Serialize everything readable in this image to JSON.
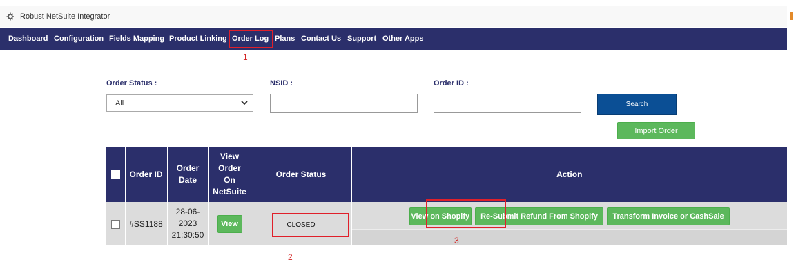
{
  "window": {
    "title": "Robust NetSuite Integrator",
    "icon": "gear-icon"
  },
  "nav": {
    "items": [
      {
        "label": "Dashboard"
      },
      {
        "label": "Configuration"
      },
      {
        "label": "Fields Mapping"
      },
      {
        "label": "Product Linking"
      },
      {
        "label": "Order Log"
      },
      {
        "label": "Plans"
      },
      {
        "label": "Contact Us"
      },
      {
        "label": "Support"
      },
      {
        "label": "Other Apps"
      }
    ],
    "active": "Order Log"
  },
  "annotations": {
    "marker1": "1",
    "marker2": "2",
    "marker3": "3",
    "color": "#e0202a"
  },
  "filters": {
    "order_status_label": "Order Status :",
    "order_status_value": "All",
    "nsid_label": "NSID :",
    "nsid_value": "",
    "order_id_label": "Order ID :",
    "order_id_value": "",
    "search_label": "Search",
    "import_label": "Import Order"
  },
  "table": {
    "headers": {
      "order_id": "Order ID",
      "order_date_line1": "Order",
      "order_date_line2": "Date",
      "view_line1": "View",
      "view_line2": "Order",
      "view_line3": "On",
      "view_line4": "NetSuite",
      "order_status": "Order Status",
      "action": "Action"
    },
    "rows": [
      {
        "order_id": "#SS1188",
        "date_line1": "28-06-",
        "date_line2": "2023",
        "date_line3": "21:30:50",
        "view_label": "View",
        "status": "CLOSED",
        "actions": [
          "View on Shopify",
          "Re-Submit Refund From Shopify",
          "Transform Invoice or CashSale"
        ]
      }
    ]
  },
  "colors": {
    "navbar": "#2b2f6b",
    "search_button": "#0b4f95",
    "green_button": "#5cb85c",
    "row_bg": "#dcdcdc"
  }
}
